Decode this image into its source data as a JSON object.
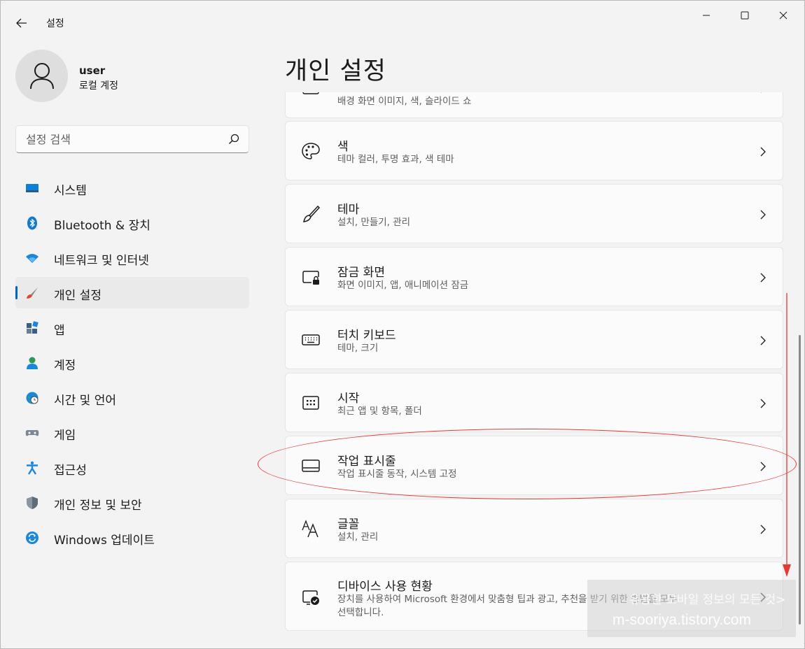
{
  "window": {
    "app_title": "설정",
    "controls": {
      "minimize": "minimize-icon",
      "maximize": "maximize-icon",
      "close": "close-icon"
    }
  },
  "profile": {
    "name": "user",
    "account_type": "로컬 계정"
  },
  "search": {
    "placeholder": "설정 검색"
  },
  "sidebar": {
    "items": [
      {
        "label": "시스템",
        "icon": "system-icon"
      },
      {
        "label": "Bluetooth & 장치",
        "icon": "bluetooth-icon"
      },
      {
        "label": "네트워크 및 인터넷",
        "icon": "wifi-icon"
      },
      {
        "label": "개인 설정",
        "icon": "brush-icon",
        "active": true
      },
      {
        "label": "앱",
        "icon": "apps-icon"
      },
      {
        "label": "계정",
        "icon": "account-icon"
      },
      {
        "label": "시간 및 언어",
        "icon": "globe-clock-icon"
      },
      {
        "label": "게임",
        "icon": "gamepad-icon"
      },
      {
        "label": "접근성",
        "icon": "accessibility-icon"
      },
      {
        "label": "개인 정보 및 보안",
        "icon": "shield-icon"
      },
      {
        "label": "Windows 업데이트",
        "icon": "update-icon"
      }
    ]
  },
  "main": {
    "title": "개인 설정",
    "cards": [
      {
        "title": "",
        "subtitle": "배경 화면 이미지, 색, 슬라이드 쇼",
        "icon": "image-icon"
      },
      {
        "title": "색",
        "subtitle": "테마 컬러, 투명 효과, 색 테마",
        "icon": "palette-icon"
      },
      {
        "title": "테마",
        "subtitle": "설치, 만들기, 관리",
        "icon": "brush-icon"
      },
      {
        "title": "잠금 화면",
        "subtitle": "화면 이미지, 앱, 애니메이션 잠금",
        "icon": "lock-screen-icon"
      },
      {
        "title": "터치 키보드",
        "subtitle": "테마, 크기",
        "icon": "keyboard-icon"
      },
      {
        "title": "시작",
        "subtitle": "최근 앱 및 항목, 폴더",
        "icon": "start-icon"
      },
      {
        "title": "작업 표시줄",
        "subtitle": "작업 표시줄 동작, 시스템 고정",
        "icon": "taskbar-icon"
      },
      {
        "title": "글꼴",
        "subtitle": "설치, 관리",
        "icon": "font-icon"
      },
      {
        "title": "디바이스 사용 현황",
        "subtitle": "장치를 사용하여 Microsoft 환경에서 맞춤형 팁과 광고, 추천을 받기 위한 방법을 모두",
        "subtitle2": "선택합니다.",
        "icon": "device-usage-icon"
      }
    ]
  },
  "annotation": {
    "color": "#e53935"
  },
  "watermark": {
    "line1": "유용한 모바일 정보의 모든 것>",
    "line2": "m-sooriya.tistory.com"
  },
  "accent_color": "#0067c0"
}
